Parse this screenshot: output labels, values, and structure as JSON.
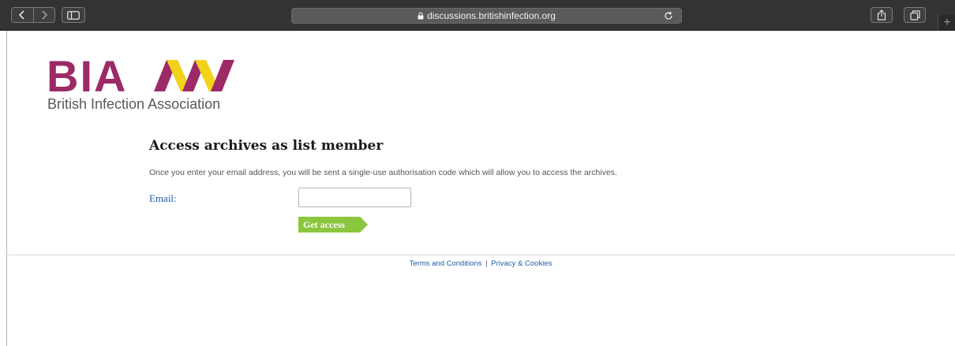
{
  "browser": {
    "url": "discussions.britishinfection.org",
    "icons": {
      "back": "chevron-left-icon",
      "forward": "chevron-right-icon",
      "sidebar": "sidebar-icon",
      "lock": "lock-icon",
      "reload": "reload-icon",
      "share": "share-icon",
      "tabs": "tabs-icon",
      "new_tab": "plus-icon"
    },
    "new_tab_label": "+"
  },
  "logo": {
    "letters": "BIA",
    "subtitle": "British Infection Association",
    "colors": {
      "primary": "#9c2a66",
      "accent": "#f2d21b"
    }
  },
  "main": {
    "heading": "Access archives as list member",
    "intro": "Once you enter your email address, you will be sent a single-use authorisation code which will allow you to access the archives.",
    "email_label": "Email:",
    "email_value": "",
    "submit_label": "Get access"
  },
  "footer": {
    "terms": "Terms and Conditions",
    "separator": "|",
    "privacy": "Privacy & Cookies"
  },
  "colors": {
    "link": "#1f5ea8",
    "button": "#8cc63f",
    "toolbar": "#333333"
  }
}
